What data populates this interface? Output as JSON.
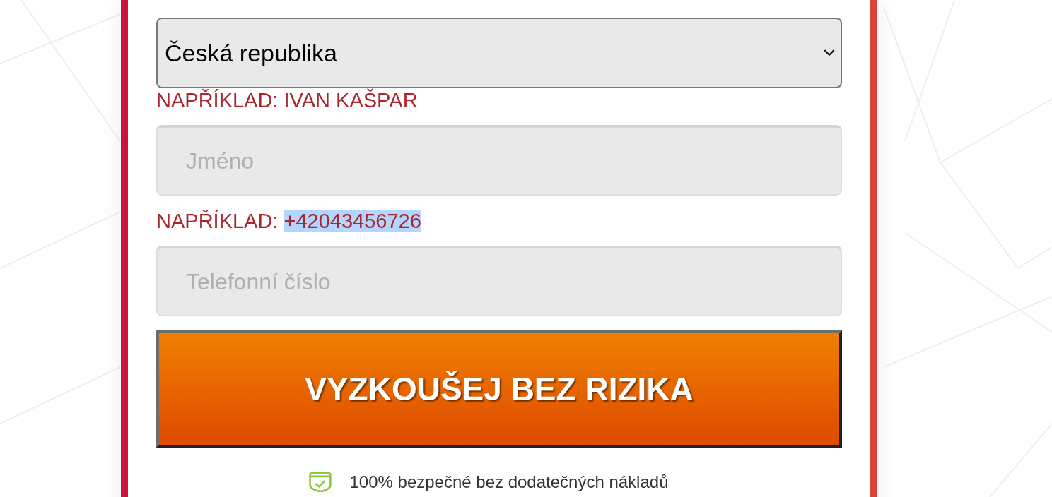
{
  "country_select": {
    "value": "Česká republika"
  },
  "fields": [
    {
      "hint_prefix": "NAPŘÍKLAD:",
      "hint_example": "IVAN KAŠPAR",
      "example_selected": false,
      "placeholder": "Jméno"
    },
    {
      "hint_prefix": "NAPŘÍKLAD:",
      "hint_example": "+42043456726",
      "example_selected": true,
      "placeholder": "Telefonní číslo"
    }
  ],
  "submit_button": {
    "label": "VYZKOUŠEJ BEZ RIZIKA"
  },
  "guarantee": {
    "text": "100% bezpečné bez dodatečných nákladů"
  }
}
